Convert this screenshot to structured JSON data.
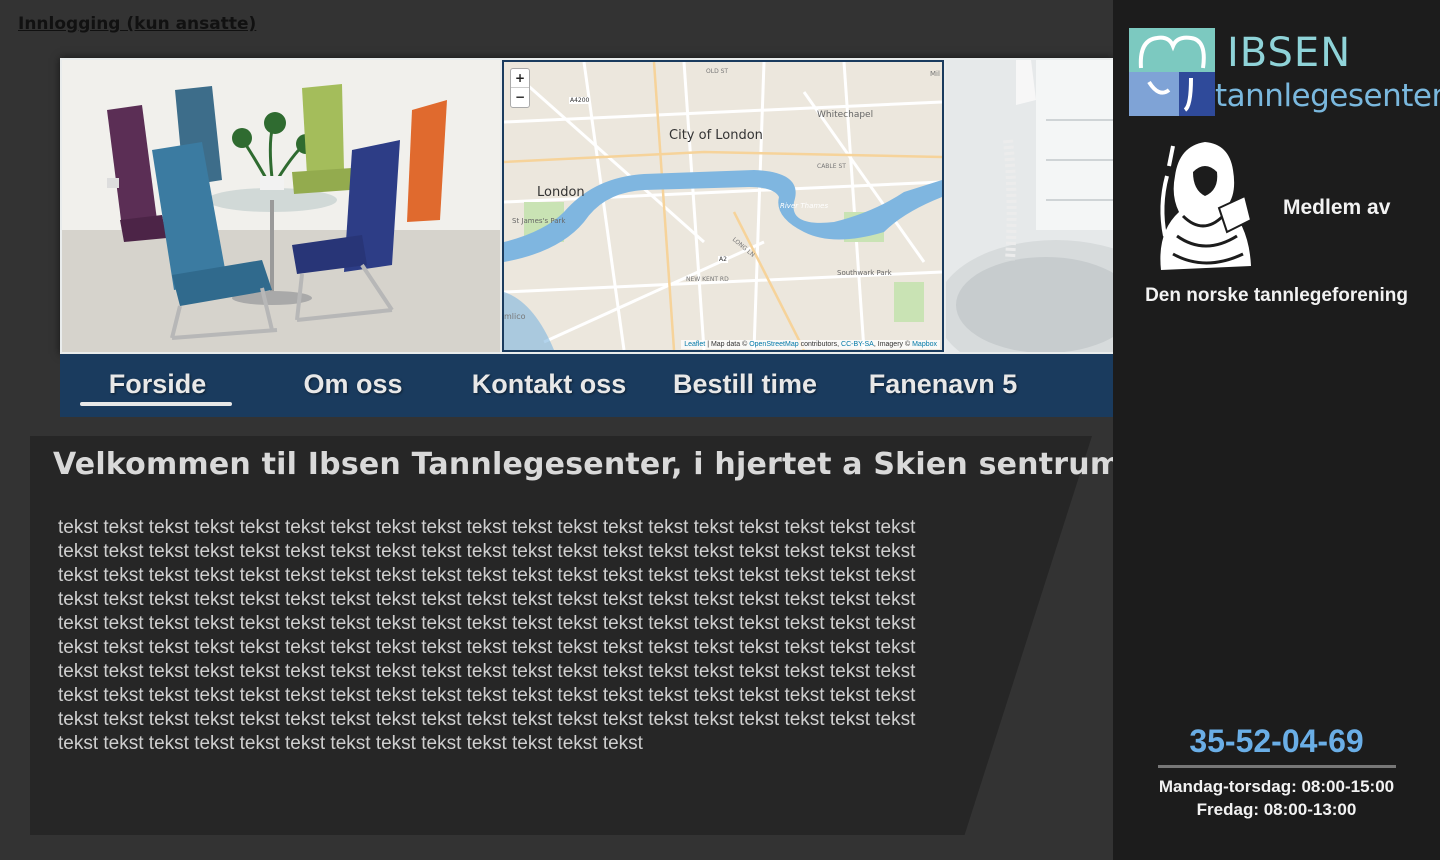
{
  "login": {
    "label": "Innlogging (kun ansatte)"
  },
  "banner": {
    "map": {
      "zoom_in": "+",
      "zoom_out": "−",
      "labels": {
        "city_of_london": "City of London",
        "london": "London",
        "whitechapel": "Whitechapel",
        "st_james": "St James's Park",
        "southwark_park": "Southwark Park",
        "river_thames": "River Thames",
        "a4200": "A4200",
        "a2": "A2",
        "cable_st": "CABLE ST",
        "new_kent_rd": "NEW KENT RD",
        "long_ln": "LONG LN",
        "old_st": "OLD ST",
        "mil": "Mil",
        "lico": "mlico"
      },
      "attribution": {
        "leaflet": "Leaflet",
        "map_data": " | Map data © ",
        "osm": "OpenStreetMap",
        "contributors": " contributors, ",
        "license": "CC-BY-SA",
        "imagery": ", Imagery © ",
        "mapbox": "Mapbox"
      }
    }
  },
  "nav": {
    "items": [
      {
        "label": "Forside",
        "active": true
      },
      {
        "label": "Om oss"
      },
      {
        "label": "Kontakt oss"
      },
      {
        "label": "Bestill time"
      },
      {
        "label": "Fanenavn 5"
      }
    ]
  },
  "main": {
    "title": "Velkommen til Ibsen Tannlegesenter, i hjertet a Skien sentrum",
    "body": "tekst tekst tekst tekst tekst tekst tekst tekst tekst tekst tekst tekst tekst tekst tekst tekst tekst tekst tekst tekst tekst tekst tekst tekst tekst tekst tekst tekst tekst tekst tekst tekst tekst tekst tekst tekst tekst tekst tekst tekst tekst tekst tekst tekst tekst tekst tekst tekst tekst tekst tekst tekst tekst tekst tekst tekst tekst tekst tekst tekst tekst tekst tekst tekst tekst tekst tekst tekst tekst tekst tekst tekst tekst tekst tekst tekst tekst tekst tekst tekst tekst tekst tekst tekst tekst tekst tekst tekst tekst tekst tekst tekst tekst tekst tekst tekst tekst tekst tekst tekst tekst tekst tekst tekst tekst tekst tekst tekst tekst tekst tekst tekst tekst tekst tekst tekst tekst tekst tekst tekst tekst tekst tekst tekst tekst tekst tekst tekst tekst tekst tekst tekst tekst tekst tekst tekst tekst tekst tekst tekst tekst tekst tekst tekst tekst tekst tekst tekst tekst tekst tekst tekst tekst tekst tekst tekst tekst tekst tekst tekst tekst tekst tekst tekst tekst tekst tekst tekst tekst tekst tekst tekst tekst tekst tekst tekst tekst tekst tekst tekst tekst tekst tekst tekst"
  },
  "sidebar": {
    "logo": {
      "line1": "IBSEN",
      "line2": "tannlegesenter"
    },
    "member": {
      "label": "Medlem av",
      "org": "Den norske tannlegeforening"
    },
    "phone": "35-52-04-69",
    "hours": {
      "line1": "Mandag-torsdag: 08:00-15:00",
      "line2": "Fredag: 08:00-13:00"
    }
  },
  "colors": {
    "nav_bg": "#1a3b5e",
    "phone": "#6aaee6",
    "logo_teal": "#8fd3d8",
    "logo_blue": "#7ab8de"
  }
}
